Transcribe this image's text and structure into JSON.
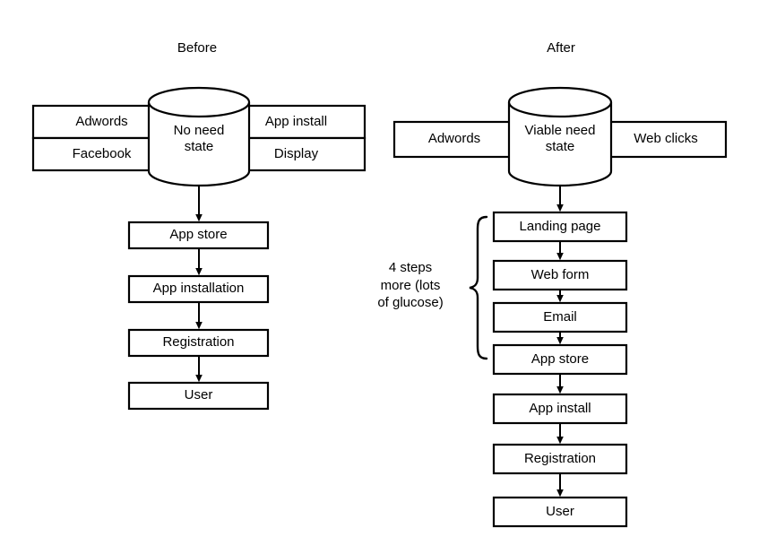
{
  "figure": {
    "background_color": "#ffffff",
    "stroke_color": "#000000"
  },
  "columns": [
    {
      "id": "before",
      "title": "Before",
      "database": {
        "label": "No need\nstate",
        "shape": "cylinder"
      },
      "left_inputs": [
        "Adwords",
        "Facebook"
      ],
      "right_inputs": [
        "App install",
        "Display"
      ],
      "steps": [
        "App store",
        "App installation",
        "Registration",
        "User"
      ]
    },
    {
      "id": "after",
      "title": "After",
      "database": {
        "label": "Viable need\nstate",
        "shape": "cylinder"
      },
      "left_inputs": [
        "Adwords"
      ],
      "right_inputs": [
        "Web clicks"
      ],
      "steps": [
        "Landing page",
        "Web form",
        "Email",
        "App store",
        "App install",
        "Registration",
        "User"
      ],
      "annotation": {
        "text": "4 steps\nmore (lots\nof glucose)",
        "brace_covers": [
          "Landing page",
          "Web form",
          "Email",
          "App store"
        ]
      }
    }
  ],
  "labels": {
    "before_title": "Before",
    "after_title": "After",
    "before_db": "No need\nstate",
    "after_db": "Viable need\nstate",
    "before_left_0": "Adwords",
    "before_left_1": "Facebook",
    "before_right_0": "App install",
    "before_right_1": "Display",
    "before_step_0": "App store",
    "before_step_1": "App installation",
    "before_step_2": "Registration",
    "before_step_3": "User",
    "after_left_0": "Adwords",
    "after_right_0": "Web clicks",
    "after_step_0": "Landing page",
    "after_step_1": "Web form",
    "after_step_2": "Email",
    "after_step_3": "App store",
    "after_step_4": "App install",
    "after_step_5": "Registration",
    "after_step_6": "User",
    "annotation_text": "4 steps\nmore (lots\nof glucose)"
  }
}
